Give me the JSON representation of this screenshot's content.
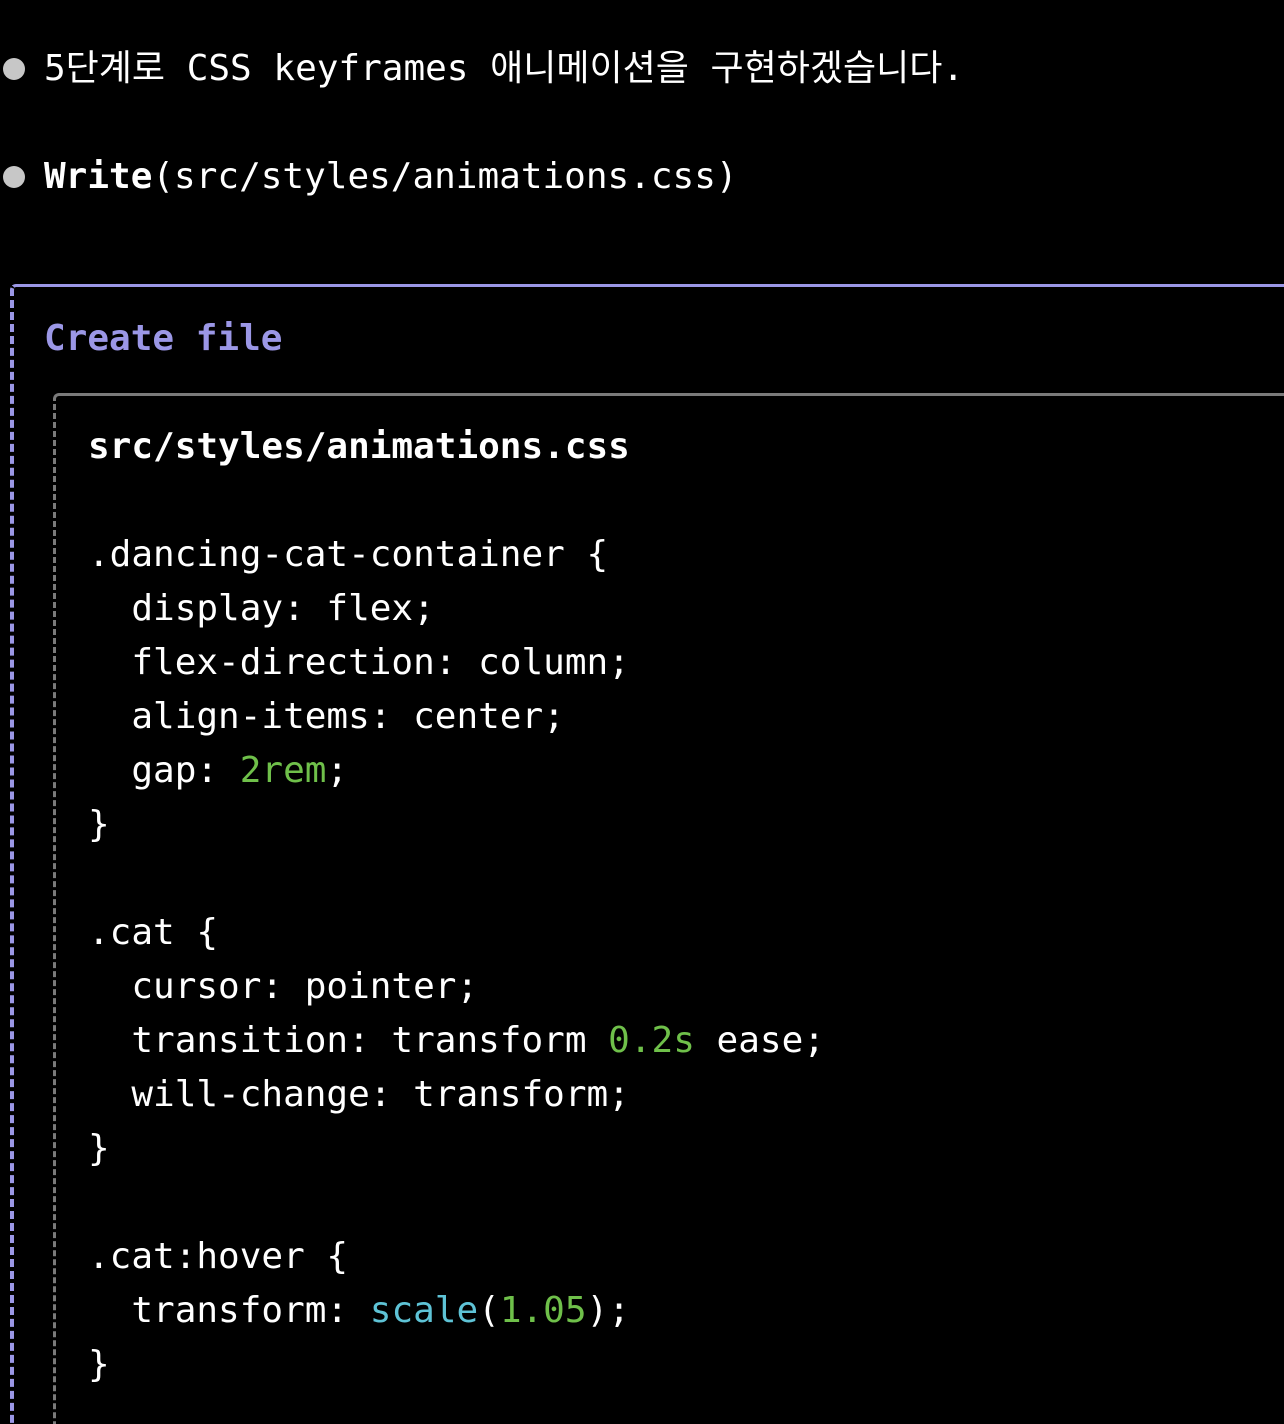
{
  "message": {
    "text": "5단계로 CSS keyframes 애니메이션을 구현하겠습니다."
  },
  "tool_call": {
    "name": "Write",
    "args": "(src/styles/animations.css)"
  },
  "panel": {
    "title": "Create file",
    "filename": "src/styles/animations.css"
  },
  "code": {
    "l1": ".dancing-cat-container {",
    "l2": "  display: flex;",
    "l3": "  flex-direction: column;",
    "l4": "  align-items: center;",
    "l5_pre": "  gap: ",
    "l5_num": "2rem",
    "l5_post": ";",
    "l6": "}",
    "l8": ".cat {",
    "l9": "  cursor: pointer;",
    "l10_pre": "  transition: transform ",
    "l10_num": "0.2s",
    "l10_post": " ease;",
    "l11": "  will-change: transform;",
    "l12": "}",
    "l14": ".cat:hover {",
    "l15_pre": "  transform: ",
    "l15_fn": "scale",
    "l15_paren_open": "(",
    "l15_num": "1.05",
    "l15_post": ");",
    "l16": "}"
  },
  "colors": {
    "accent": "#9b97e6",
    "number": "#6fc04a",
    "function": "#5ec3d6"
  }
}
